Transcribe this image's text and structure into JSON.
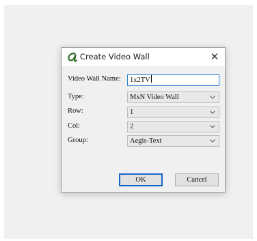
{
  "dialog": {
    "title": "Create Video Wall",
    "close_glyph": "✕",
    "icon": "alpha-logo-icon",
    "accent_color": "#2f6f2a"
  },
  "form": {
    "name_label": "Video Wall Name:",
    "name_value": "1x2TV",
    "type_label": "Type:",
    "type_value": "MxN Video Wall",
    "row_label": "Row:",
    "row_value": "1",
    "col_label": "Col:",
    "col_value": "2",
    "group_label": "Group:",
    "group_value": "Aegis-Text"
  },
  "buttons": {
    "ok_label": "OK",
    "cancel_label": "Cancel"
  }
}
